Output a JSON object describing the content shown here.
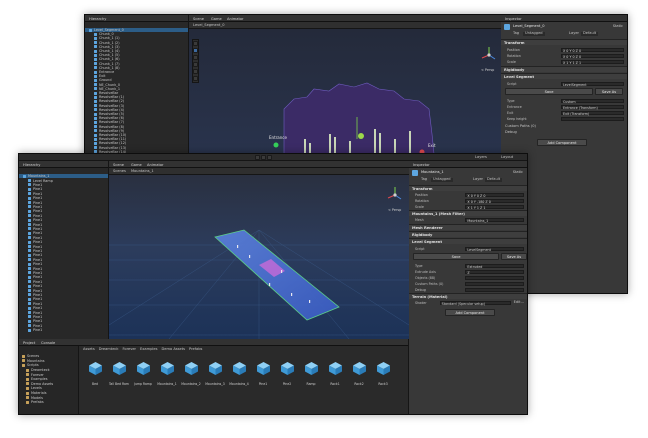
{
  "back_window": {
    "hierarchy_tab": "Hierarchy",
    "scene_tabs": [
      "Scene",
      "Game",
      "Animator"
    ],
    "selected_object": "Level_Segment_0",
    "hierarchy_items": [
      "Level_Segment_0",
      "Chunk_0",
      "Chunk_1 (1)",
      "Chunk_1 (2)",
      "Chunk_1 (3)",
      "Chunk_1 (4)",
      "Chunk_1 (5)",
      "Chunk_1 (6)",
      "Chunk_1 (7)",
      "Chunk_1 (8)",
      "Entrance",
      "Exit",
      "Ground",
      "NE_Chunk_0",
      "NE_Chunk_1",
      "RevolveBar",
      "RevolveBar (1)",
      "RevolveBar (2)",
      "RevolveBar (3)",
      "RevolveBar (4)",
      "RevolveBar (5)",
      "RevolveBar (6)",
      "RevolveBar (7)",
      "RevolveBar (8)",
      "RevolveBar (9)",
      "RevolveBar (10)",
      "RevolveBar (11)",
      "RevolveBar (12)",
      "RevolveBar (13)",
      "RevolveBar (14)",
      "RevolveBar (15)"
    ],
    "gizmo_label": "< Persp",
    "scene_labels": {
      "entrance": "Entrance",
      "exit": "Exit"
    },
    "inspector": {
      "tab": "Inspector",
      "object_name": "Level_Segment_0",
      "static_label": "Static",
      "tag_label": "Tag",
      "tag_value": "Untagged",
      "layer_label": "Layer",
      "layer_value": "Default",
      "transform_header": "Transform",
      "transform_rows": [
        {
          "k": "Position",
          "v": "X 0   Y 0   Z 0"
        },
        {
          "k": "Rotation",
          "v": "X 0   Y 0   Z 0"
        },
        {
          "k": "Scale",
          "v": "X 1   Y 1   Z 1"
        }
      ],
      "rigidbody_header": "Rigidbody",
      "segment_header": "Level Segment",
      "script_label": "Script",
      "script_value": "LevelSegment",
      "save_label": "Save",
      "save_as_label": "Save As",
      "fields": [
        {
          "k": "Type",
          "v": "Custom"
        },
        {
          "k": "Entrance",
          "v": "Entrance (Transform)"
        },
        {
          "k": "Exit",
          "v": "Exit (Transform)"
        },
        {
          "k": "Keep height",
          "v": ""
        }
      ],
      "foldouts": [
        "Custom Paths (0)",
        "Debug"
      ],
      "add_component_label": "Add Component"
    }
  },
  "front_window": {
    "hierarchy_tab": "Hierarchy",
    "scene_tabs": [
      "Scene",
      "Game",
      "Animator"
    ],
    "breadcrumb": [
      "Scenes",
      "Mountains_1"
    ],
    "selected_object": "Mountains_1",
    "hierarchy_items": [
      "Mountains_1",
      "Level Ramp",
      "Pine1",
      "Pine1",
      "Pine1",
      "Pine1",
      "Pine1",
      "Pine1",
      "Pine1",
      "Pine1",
      "Pine1",
      "Pine1",
      "Pine1",
      "Pine1",
      "Pine1",
      "Pine1",
      "Pine1",
      "Pine1",
      "Pine1",
      "Pine1",
      "Pine1",
      "Pine1",
      "Pine1",
      "Pine1",
      "Pine1",
      "Pine1",
      "Pine1",
      "Pine1",
      "Pine1",
      "Pine1",
      "Pine1",
      "Pine1",
      "Pine1",
      "Pine1",
      "Pine1",
      "Pine1",
      "Pine1",
      "Pine1",
      "Pine1",
      "Pine1",
      "Pine1",
      "Pine1",
      "Pine1",
      "Pine1",
      "Pine1",
      "Pine1",
      "Pine1",
      "Pine1",
      "Pine1",
      "Pine1",
      "Pine1",
      "Pine1",
      "Pine1",
      "Pine1",
      "Pine1",
      "Pine1",
      "Pine1",
      "Pine1",
      "Pine1",
      "Pine1"
    ],
    "tail_items": [
      "Pine2",
      "Tall Bed Ramp",
      "Ramp",
      "Ramp"
    ],
    "gizmo_label": "< Persp",
    "layers_label": "Layers",
    "layout_label": "Layout",
    "inspector": {
      "tab": "Inspector",
      "object_name": "Mountains_1",
      "static_label": "Static",
      "tag_label": "Tag",
      "tag_value": "Untagged",
      "layer_label": "Layer",
      "layer_value": "Default",
      "transform_header": "Transform",
      "transform_rows": [
        {
          "k": "Position",
          "v": "X 0   Y 0   Z 0"
        },
        {
          "k": "Rotation",
          "v": "X 0   Y -180   Z 0"
        },
        {
          "k": "Scale",
          "v": "X 1   Y 1   Z 1"
        }
      ],
      "mesh_header": "Mountains_1 (Mesh Filter)",
      "mesh_row": {
        "k": "Mesh",
        "v": "Mountains_1"
      },
      "mesh_renderer_header": "Mesh Renderer",
      "rigidbody_header": "Rigidbody",
      "segment_header": "Level Segment",
      "script_label": "Script",
      "script_value": "LevelSegment",
      "save_label": "Save",
      "save_as_label": "Save As",
      "fields": [
        {
          "k": "Type",
          "v": "Extruded"
        },
        {
          "k": "Extrude Axis",
          "v": "Z"
        },
        {
          "k": "Objects (88)",
          "v": ""
        },
        {
          "k": "Custom Paths (0)",
          "v": ""
        },
        {
          "k": "Debug",
          "v": ""
        }
      ],
      "material_header": "Terrain (Material)",
      "shader_label": "Shader",
      "shader_value": "Standard (Specular setup)",
      "edit_label": "Edit...",
      "add_component_label": "Add Component"
    },
    "project": {
      "tabs": [
        "Project",
        "Console"
      ],
      "breadcrumb": [
        "Assets",
        "Dreamteck",
        "Forever",
        "Examples",
        "Demo Assets",
        "Prefabs"
      ],
      "tree_items": [
        "Scenes",
        "Mountains",
        "Scripts",
        "Dreamteck",
        "Forever",
        "Examples",
        "Demo Assets",
        "Levels",
        "Materials",
        "Models",
        "Prefabs"
      ],
      "assets": [
        "Bed",
        "Tall Bed Ramp",
        "Jump Ramp",
        "Mountains_1",
        "Mountains_2",
        "Mountains_3",
        "Mountains_4",
        "Pine1",
        "Pine2",
        "Ramp",
        "Rock1",
        "Rock2",
        "Rock3"
      ]
    }
  }
}
